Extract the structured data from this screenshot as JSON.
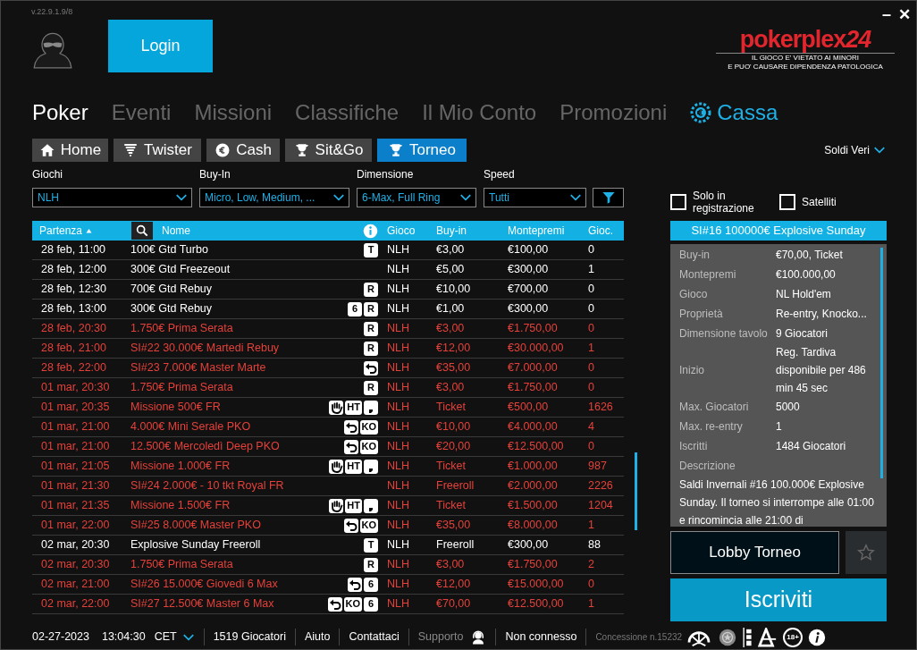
{
  "version": "v.22.9.1.9/8",
  "login_button": "Login",
  "window_controls": [
    "–",
    "✕"
  ],
  "logo": {
    "brand": "pokerplex",
    "number": "24",
    "tagline": [
      "IL GIOCO E' VIETATO AI MINORI",
      "E PUO' CAUSARE DIPENDENZA PATOLOGICA"
    ]
  },
  "nav": [
    {
      "label": "Poker",
      "kind": "section",
      "selected": true
    },
    {
      "label": "Eventi",
      "kind": "section",
      "selected": false
    },
    {
      "label": "Missioni",
      "kind": "section",
      "selected": false
    },
    {
      "label": "Classifiche",
      "kind": "section",
      "selected": false
    },
    {
      "label": "Il Mio Conto",
      "kind": "section",
      "selected": false
    },
    {
      "label": "Promozioni",
      "kind": "section",
      "selected": false
    },
    {
      "label": "Cassa",
      "kind": "cashier",
      "selected": false
    }
  ],
  "tabs": [
    {
      "label": "Home",
      "selected": false
    },
    {
      "label": "Twister",
      "selected": false
    },
    {
      "label": "Cash",
      "selected": false
    },
    {
      "label": "Sit&Go",
      "selected": false
    },
    {
      "label": "Torneo",
      "selected": true
    }
  ],
  "currency_menu": "Soldi Veri",
  "filters": [
    {
      "label": "Giochi",
      "value": "NLH"
    },
    {
      "label": "Buy-In",
      "value": "Micro, Low, Medium, ..."
    },
    {
      "label": "Dimensione",
      "value": "6-Max, Full Ring"
    },
    {
      "label": "Speed",
      "value": "Tutti"
    }
  ],
  "checkboxes": [
    {
      "label": "Solo in registrazione",
      "checked": false
    },
    {
      "label": "Satelliti",
      "checked": false
    }
  ],
  "table": {
    "columns": [
      "Partenza",
      "Nome",
      "Gioco",
      "Buy-in",
      "Montepremi",
      "Gioc."
    ],
    "rows": [
      {
        "start": "28 feb, 11:00",
        "name": "100€ Gtd Turbo",
        "badges": [
          {
            "kind": "letter",
            "text": "T"
          }
        ],
        "game": "NLH",
        "buy_in": "€3,00",
        "prize": "€100,00",
        "players": "0",
        "highlighted": false
      },
      {
        "start": "28 feb, 12:00",
        "name": "300€ Gtd Freezeout",
        "badges": [],
        "game": "NLH",
        "buy_in": "€5,00",
        "prize": "€300,00",
        "players": "1",
        "highlighted": false
      },
      {
        "start": "28 feb, 12:30",
        "name": "700€ Gtd Rebuy",
        "badges": [
          {
            "kind": "letter",
            "text": "R"
          }
        ],
        "game": "NLH",
        "buy_in": "€10,00",
        "prize": "€700,00",
        "players": "0",
        "highlighted": false
      },
      {
        "start": "28 feb, 13:00",
        "name": "300€ Gtd Rebuy",
        "badges": [
          {
            "kind": "letter",
            "text": "6"
          },
          {
            "kind": "letter",
            "text": "R"
          }
        ],
        "game": "NLH",
        "buy_in": "€1,00",
        "prize": "€300,00",
        "players": "0",
        "highlighted": false
      },
      {
        "start": "28 feb, 20:30",
        "name": "1.750€ Prima Serata",
        "badges": [
          {
            "kind": "letter",
            "text": "R"
          }
        ],
        "game": "NLH",
        "buy_in": "€3,00",
        "prize": "€1.750,00",
        "players": "0",
        "highlighted": true
      },
      {
        "start": "28 feb, 21:00",
        "name": "SI#22 30.000€ Martedi Rebuy",
        "badges": [
          {
            "kind": "letter",
            "text": "R"
          }
        ],
        "game": "NLH",
        "buy_in": "€12,00",
        "prize": "€30.000,00",
        "players": "1",
        "highlighted": true
      },
      {
        "start": "28 feb, 22:00",
        "name": "SI#23 7.000€ Master Marte",
        "badges": [
          {
            "kind": "reentry"
          }
        ],
        "game": "NLH",
        "buy_in": "€35,00",
        "prize": "€7.000,00",
        "players": "0",
        "highlighted": true
      },
      {
        "start": "01 mar, 20:30",
        "name": "1.750€ Prima Serata",
        "badges": [
          {
            "kind": "letter",
            "text": "R"
          }
        ],
        "game": "NLH",
        "buy_in": "€3,00",
        "prize": "€1.750,00",
        "players": "0",
        "highlighted": true
      },
      {
        "start": "01 mar, 20:35",
        "name": "Missione 500€ FR",
        "badges": [
          {
            "kind": "hand"
          },
          {
            "kind": "letter",
            "text": "HT"
          },
          {
            "kind": "dot"
          }
        ],
        "game": "NLH",
        "buy_in": "Ticket",
        "prize": "€500,00",
        "players": "1626",
        "highlighted": true
      },
      {
        "start": "01 mar, 21:00",
        "name": "4.000€ Mini Serale PKO",
        "badges": [
          {
            "kind": "reentry"
          },
          {
            "kind": "letter",
            "text": "KO"
          }
        ],
        "game": "NLH",
        "buy_in": "€10,00",
        "prize": "€4.000,00",
        "players": "4",
        "highlighted": true
      },
      {
        "start": "01 mar, 21:00",
        "name": "12.500€ Mercoledì Deep PKO",
        "badges": [
          {
            "kind": "reentry"
          },
          {
            "kind": "letter",
            "text": "KO"
          }
        ],
        "game": "NLH",
        "buy_in": "€20,00",
        "prize": "€12.500,00",
        "players": "0",
        "highlighted": true
      },
      {
        "start": "01 mar, 21:05",
        "name": "Missione 1.000€ FR",
        "badges": [
          {
            "kind": "hand"
          },
          {
            "kind": "letter",
            "text": "HT"
          },
          {
            "kind": "dot"
          }
        ],
        "game": "NLH",
        "buy_in": "Ticket",
        "prize": "€1.000,00",
        "players": "987",
        "highlighted": true
      },
      {
        "start": "01 mar, 21:30",
        "name": "SI#24 2.000€ - 10 tkt Royal FR",
        "badges": [],
        "game": "NLH",
        "buy_in": "Freeroll",
        "prize": "€2.000,00",
        "players": "2226",
        "highlighted": true
      },
      {
        "start": "01 mar, 21:35",
        "name": "Missione 1.500€ FR",
        "badges": [
          {
            "kind": "hand"
          },
          {
            "kind": "letter",
            "text": "HT"
          },
          {
            "kind": "dot"
          }
        ],
        "game": "NLH",
        "buy_in": "Ticket",
        "prize": "€1.500,00",
        "players": "1204",
        "highlighted": true
      },
      {
        "start": "01 mar, 22:00",
        "name": "SI#25 8.000€ Master PKO",
        "badges": [
          {
            "kind": "reentry"
          },
          {
            "kind": "letter",
            "text": "KO"
          }
        ],
        "game": "NLH",
        "buy_in": "€35,00",
        "prize": "€8.000,00",
        "players": "1",
        "highlighted": true
      },
      {
        "start": "02 mar, 20:30",
        "name": "Explosive Sunday Freeroll",
        "badges": [
          {
            "kind": "letter",
            "text": "T"
          }
        ],
        "game": "NLH",
        "buy_in": "Freeroll",
        "prize": "€300,00",
        "players": "88",
        "highlighted": false
      },
      {
        "start": "02 mar, 20:30",
        "name": "1.750€ Prima Serata",
        "badges": [
          {
            "kind": "letter",
            "text": "R"
          }
        ],
        "game": "NLH",
        "buy_in": "€3,00",
        "prize": "€1.750,00",
        "players": "2",
        "highlighted": true
      },
      {
        "start": "02 mar, 21:00",
        "name": "SI#26 15.000€ Giovedi 6 Max",
        "badges": [
          {
            "kind": "reentry"
          },
          {
            "kind": "letter",
            "text": "6"
          }
        ],
        "game": "NLH",
        "buy_in": "€12,00",
        "prize": "€15.000,00",
        "players": "0",
        "highlighted": true
      },
      {
        "start": "02 mar, 22:00",
        "name": "SI#27 12.500€ Master 6 Max",
        "badges": [
          {
            "kind": "reentry"
          },
          {
            "kind": "letter",
            "text": "KO"
          },
          {
            "kind": "letter",
            "text": "6"
          }
        ],
        "game": "NLH",
        "buy_in": "€70,00",
        "prize": "€12.500,00",
        "players": "1",
        "highlighted": true
      }
    ]
  },
  "details": {
    "title": "SI#16 100000€ Explosive Sunday",
    "fields": [
      {
        "label": "Buy-in",
        "value": "€70,00, Ticket"
      },
      {
        "label": "Montepremi",
        "value": "€100.000,00"
      },
      {
        "label": "Gioco",
        "value": "NL Hold'em"
      },
      {
        "label": "Proprietà",
        "value": "Re-entry, Knocko..."
      },
      {
        "label": "Dimensione tavolo",
        "value": "9 Giocatori"
      },
      {
        "label": "Inizio",
        "value": "Reg. Tardiva disponibile per 486 min 45 sec"
      },
      {
        "label": "Max. Giocatori",
        "value": "5000"
      },
      {
        "label": "Max. re-entry",
        "value": "1"
      },
      {
        "label": "Iscritti",
        "value": "1484 Giocatori"
      }
    ],
    "description_label": "Descrizione",
    "description": "Saldi Invernali #16  100.000€ Explosive Sunday. Il torneo si interrompe alle 01:00 e rincomincia alle 21:00 di"
  },
  "lobby_button": "Lobby Torneo",
  "register_button": "Iscriviti",
  "status_bar": {
    "date": "02-27-2023",
    "time": "13:04:30",
    "timezone": "CET",
    "players": "1519 Giocatori",
    "links": [
      {
        "label": "Aiuto",
        "disabled": false
      },
      {
        "label": "Contattaci",
        "disabled": false
      },
      {
        "label": "Supporto",
        "disabled": true
      }
    ],
    "connection": "Non connesso",
    "license": "Concessione n.15232",
    "age_badge": "18+"
  }
}
